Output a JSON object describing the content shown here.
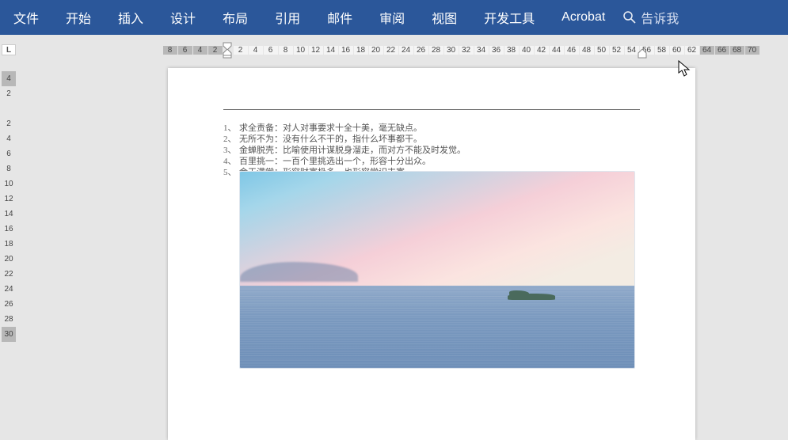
{
  "ribbon": {
    "tabs": [
      "文件",
      "开始",
      "插入",
      "设计",
      "布局",
      "引用",
      "邮件",
      "审阅",
      "视图",
      "开发工具",
      "Acrobat"
    ],
    "tellme": "告诉我"
  },
  "hruler": {
    "left_shaded": [
      "8",
      "6",
      "4",
      "2"
    ],
    "body": [
      "2",
      "4",
      "6",
      "8",
      "10",
      "12",
      "14",
      "16",
      "18",
      "20",
      "22",
      "24",
      "26",
      "28",
      "30",
      "32",
      "34",
      "36",
      "38",
      "40",
      "42",
      "44",
      "46",
      "48",
      "50",
      "52",
      "54",
      "56",
      "58",
      "60",
      "62"
    ],
    "right_shaded": [
      "64",
      "66",
      "68",
      "70"
    ]
  },
  "vruler": {
    "top_shaded": [
      "4"
    ],
    "marks": [
      "2",
      "",
      "2",
      "4",
      "6",
      "8",
      "10",
      "12",
      "14",
      "16",
      "18",
      "20",
      "22",
      "24",
      "26",
      "28"
    ],
    "bottom_shaded": [
      "30"
    ]
  },
  "ruler_corner": "L",
  "doc": {
    "items": [
      {
        "n": "1、",
        "t": "求全责备：对人对事要求十全十美，毫无缺点。"
      },
      {
        "n": "2、",
        "t": "无所不为：没有什么不干的，指什么坏事都干。"
      },
      {
        "n": "3、",
        "t": "金蝉脱壳：比喻使用计谋脱身溜走，而对方不能及时发觉。"
      },
      {
        "n": "4、",
        "t": "百里挑一：一百个里挑选出一个，形容十分出众。"
      },
      {
        "n": "5、",
        "t": "金玉满堂：形容财富极多，也形容学识丰富。"
      }
    ]
  }
}
